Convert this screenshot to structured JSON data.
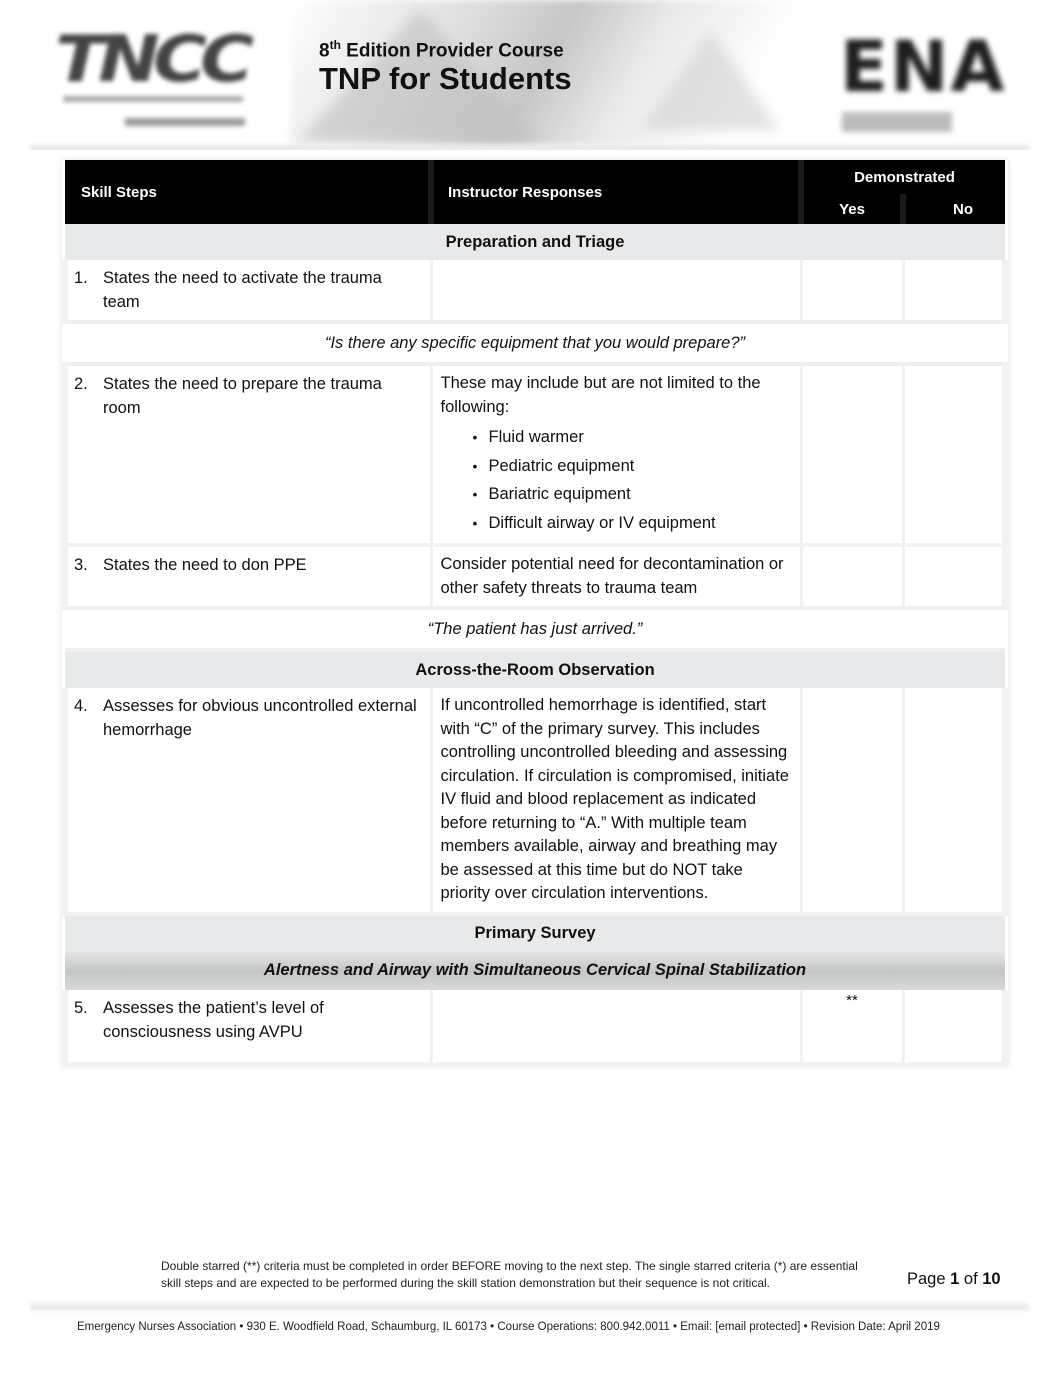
{
  "header": {
    "edition_number": "8",
    "edition_suffix": "th",
    "edition_rest": " Edition Provider Course",
    "title": "TNP for Students",
    "left_logo_text": "TNCC",
    "right_logo_text": "ENA"
  },
  "table": {
    "columns": {
      "skill": "Skill Steps",
      "response": "Instructor Responses",
      "demonstrated": "Demonstrated",
      "yes": "Yes",
      "no": "No"
    },
    "sections": {
      "prep": "Preparation and Triage",
      "across": "Across-the-Room Observation",
      "primary": "Primary Survey",
      "airway": "Alertness and Airway with Simultaneous Cervical Spinal Stabilization"
    },
    "prompts": {
      "equipment": "“Is there any specific equipment that you would prepare?”",
      "arrived": "“The patient has just arrived.”"
    },
    "steps": [
      {
        "num": "1.",
        "skill": "States the need to activate the trauma team",
        "response": "",
        "yes_mark": ""
      },
      {
        "num": "2.",
        "skill": "States the need to prepare the trauma room",
        "response": "These may include but are not limited to the following:",
        "bullets": [
          "Fluid warmer",
          "Pediatric equipment",
          "Bariatric equipment",
          "Difficult airway or IV equipment"
        ],
        "yes_mark": ""
      },
      {
        "num": "3.",
        "skill": "States the need to don PPE",
        "response": "Consider potential need for decontamination or other safety threats to trauma team",
        "yes_mark": ""
      },
      {
        "num": "4.",
        "skill": "Assesses for obvious uncontrolled external hemorrhage",
        "response": "If uncontrolled hemorrhage is identified, start with “C” of the primary survey. This includes controlling uncontrolled bleeding and assessing circulation. If circulation is compromised, initiate IV fluid and blood replacement as indicated before returning to “A.” With multiple team members available, airway and breathing may be assessed at this time but do NOT take priority over circulation interventions.",
        "yes_mark": ""
      },
      {
        "num": "5.",
        "skill": "Assesses the patient’s level of consciousness using AVPU",
        "response": "",
        "yes_mark": "**"
      }
    ]
  },
  "footer": {
    "note": "Double starred (**) criteria must be completed in order BEFORE moving to the next step. The single starred criteria (*) are essential skill steps and are expected to be performed during the skill station demonstration but their sequence is not critical.",
    "page_label": "Page ",
    "page_current": "1",
    "page_of": " of ",
    "page_total": "10",
    "address": "Emergency Nurses Association • 930 E. Woodfield Road, Schaumburg, IL 60173 • Course Operations: 800.942.0011 • Email: [email protected] • Revision Date: April 2019"
  }
}
